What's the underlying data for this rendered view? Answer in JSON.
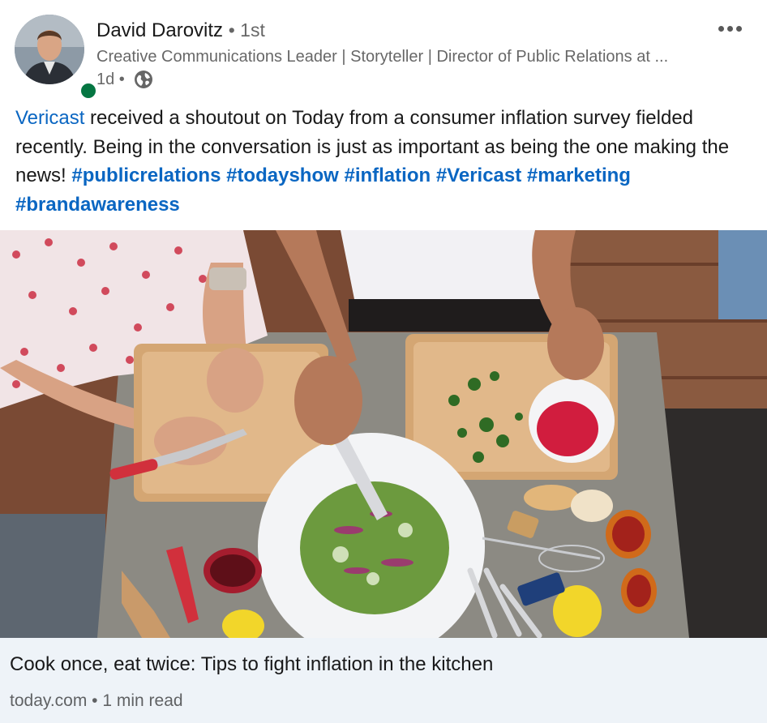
{
  "post": {
    "author": {
      "name": "David Darovitz",
      "degree": "1st",
      "headline": "Creative Communications Leader | Storyteller | Director of Public Relations at ...",
      "time_ago": "1d",
      "visibility_icon": "globe-icon",
      "online_status_color": "#057642"
    },
    "body": {
      "mention": "Vericast",
      "text": " received a shoutout on Today from a consumer inflation survey fielded recently. Being in the conversation is just as important as being the one making the news!",
      "hashtags": [
        "#publicrelations",
        "#todayshow",
        "#inflation",
        "#Vericast",
        "#marketing",
        "#brandawareness"
      ]
    },
    "more_icon": "ellipsis-icon"
  },
  "link_card": {
    "title": "Cook once, eat twice: Tips to fight inflation in the kitchen",
    "source": "today.com",
    "read_time": "1 min read"
  },
  "colors": {
    "link_blue": "#0a66c2",
    "card_bg": "#eef3f8"
  }
}
